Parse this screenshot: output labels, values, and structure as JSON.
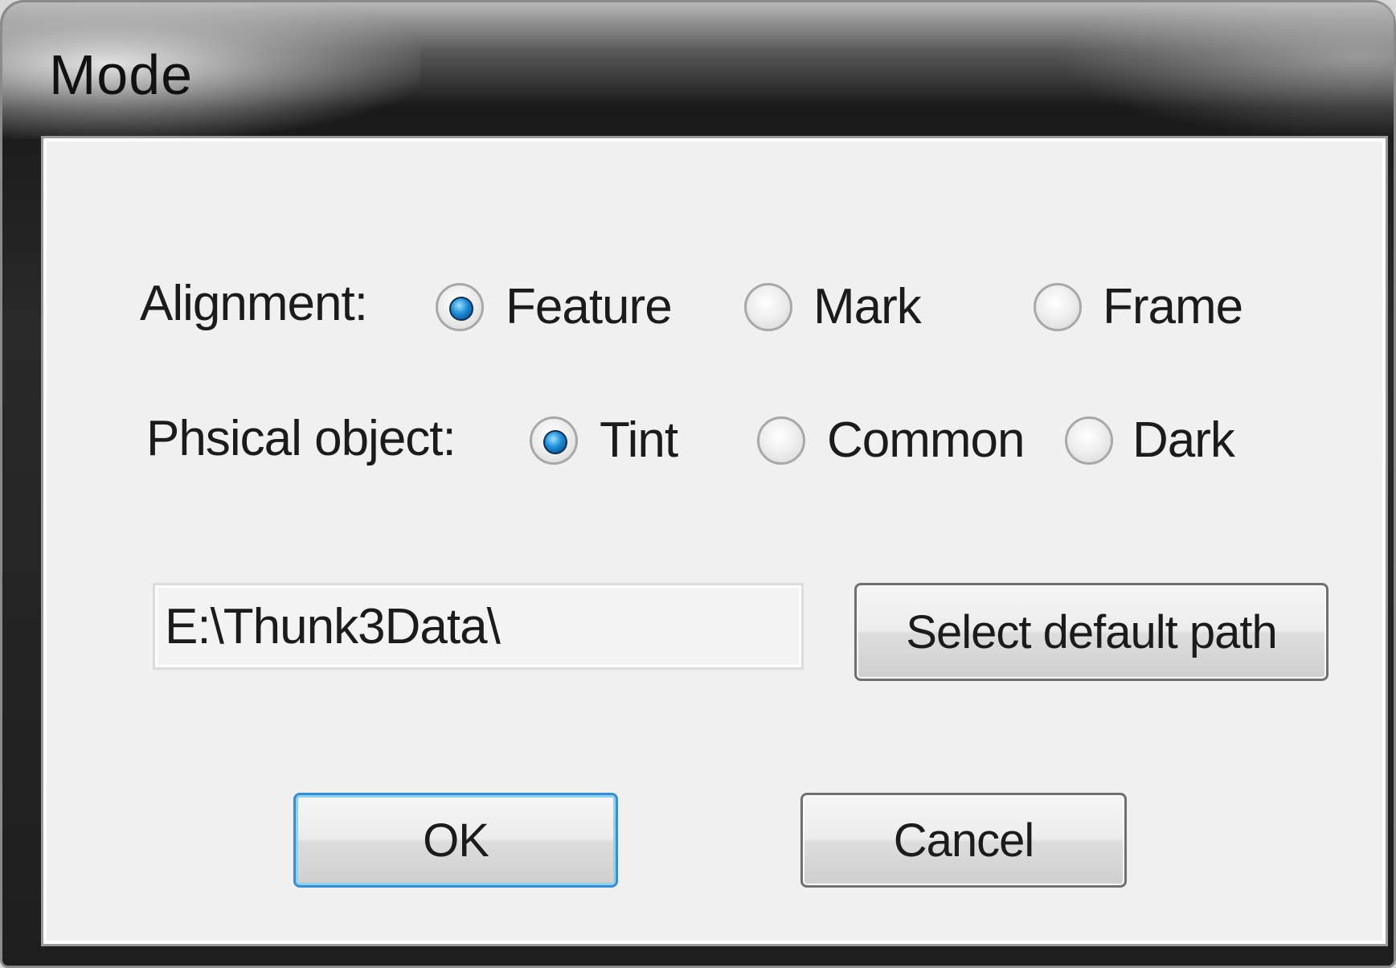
{
  "window": {
    "title": "Mode"
  },
  "alignment": {
    "label": "Alignment:",
    "options": [
      "Feature",
      "Mark",
      "Frame"
    ],
    "selected": "Feature"
  },
  "physical_object": {
    "label": "Phsical object:",
    "options": [
      "Tint",
      "Common",
      "Dark"
    ],
    "selected": "Tint"
  },
  "path": {
    "value": "E:\\Thunk3Data\\",
    "select_button": "Select default path"
  },
  "buttons": {
    "ok": "OK",
    "cancel": "Cancel"
  }
}
